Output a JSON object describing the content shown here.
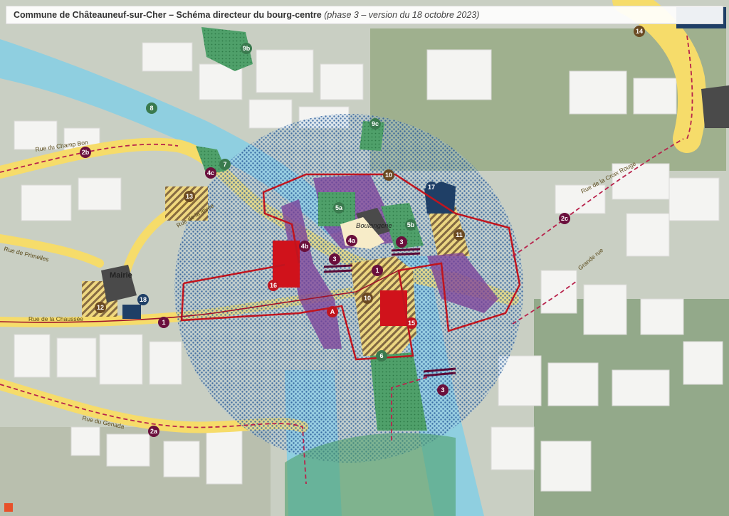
{
  "header": {
    "title_main": "Commune de Châteauneuf-sur-Cher – Schéma directeur du bourg-centre",
    "title_sub": "(phase 3 – version du 18 octobre 2023)"
  },
  "colors": {
    "road_yellow": "#f6dc6a",
    "river_blue": "#8fcfe0",
    "green_zone": "#3f9a5a",
    "red_building": "#d0121b",
    "perimeter_red": "#c0151f",
    "marker_dark": "#5a0a36",
    "hatch_brown": "#8b6a3a",
    "purple_zone": "#7c3f98",
    "dot_pattern": "#1a4a8a"
  },
  "street_labels": {
    "champ_bon": "Rue du Champ Bon",
    "primelles": "Rue de Primelles",
    "chaussee": "Rue de la Chaussée",
    "genada": "Rue du Genada",
    "croix_rouge": "Rue de la Croix Rouge",
    "grande_rue": "Grande rue",
    "levee": "Rue de la levée"
  },
  "place_labels": {
    "mairie": "Mairie",
    "boulangerie": "Boulangerie"
  },
  "markers": {
    "m1a": "1",
    "m1b": "1",
    "m2a": "2a",
    "m2b": "2b",
    "m2c": "2c",
    "m3a": "3",
    "m3b": "3",
    "m3c": "3",
    "m4a": "4a",
    "m4b": "4b",
    "m4c": "4c",
    "m5a": "5a",
    "m5b": "5b",
    "m6": "6",
    "m7": "7",
    "m8": "8",
    "m9b": "9b",
    "m9c": "9c",
    "m10a": "10",
    "m10b": "10",
    "m11": "11",
    "m12": "12",
    "m13": "13",
    "m14": "14",
    "m15": "15",
    "m16": "16",
    "m17": "17",
    "m18": "18",
    "mA": "A"
  }
}
